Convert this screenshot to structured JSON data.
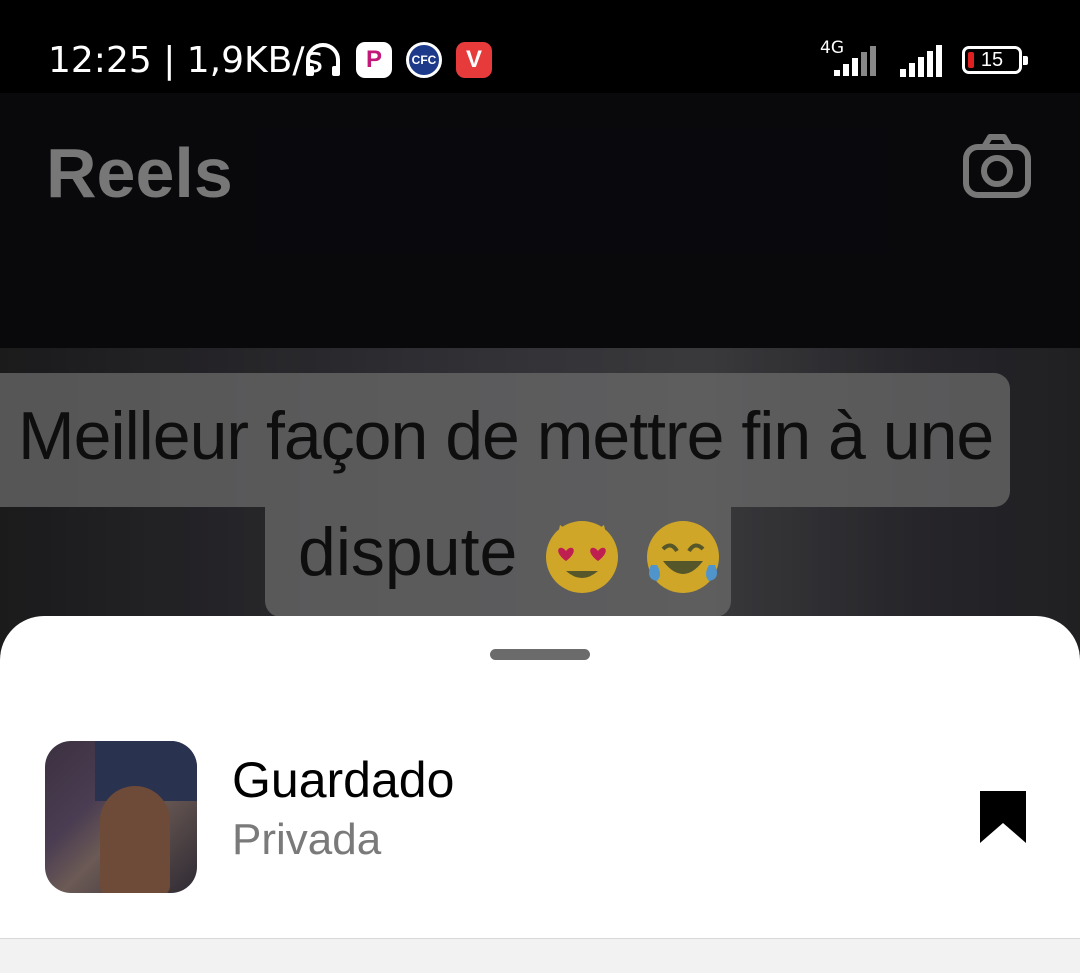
{
  "status_bar": {
    "time_speed": "12:25 | 1,9KB/s",
    "network_label": "4G",
    "battery": "15",
    "icons": [
      "headphones-icon",
      "p-app-icon",
      "chelsea-icon",
      "v-app-icon",
      "signal-icon",
      "signal-icon",
      "battery-icon"
    ]
  },
  "header": {
    "title": "Reels",
    "camera_icon": "camera-icon"
  },
  "video": {
    "caption_line1": "Meilleur façon de mettre fin à une",
    "caption_line2": "dispute"
  },
  "sheet": {
    "item": {
      "title": "Guardado",
      "subtitle": "Privada",
      "icon": "bookmark-filled-icon"
    }
  },
  "colors": {
    "sheet_bg": "#ffffff",
    "title_gray": "#8c8c8c",
    "subtitle_gray": "#7a7a7a",
    "battery_low": "#e02020"
  }
}
